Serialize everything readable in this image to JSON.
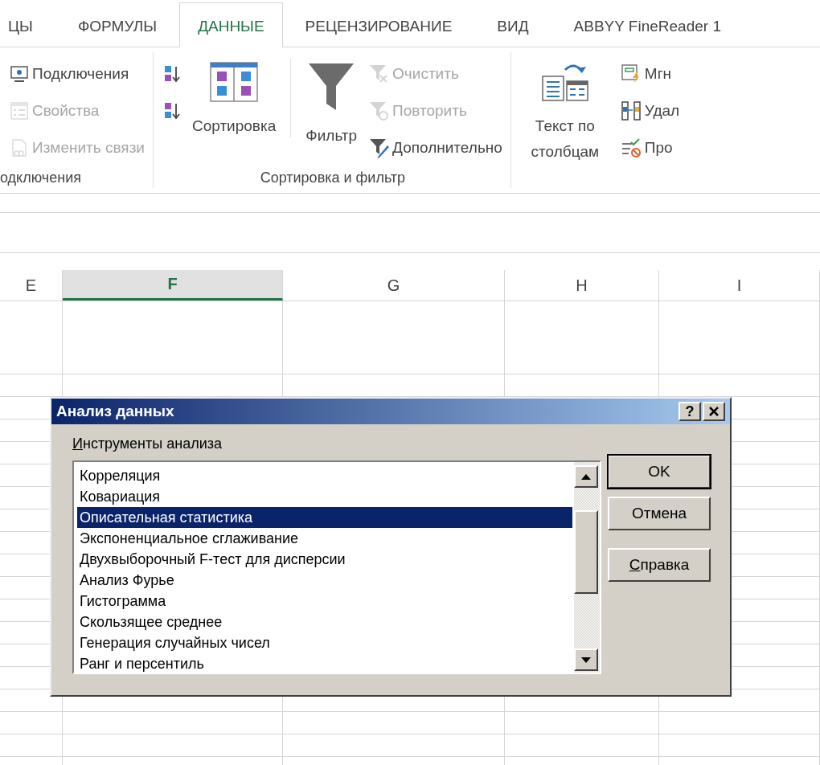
{
  "ribbon_tabs": [
    {
      "label": "ЦЫ",
      "selected": false
    },
    {
      "label": "ФОРМУЛЫ",
      "selected": false
    },
    {
      "label": "ДАННЫЕ",
      "selected": true
    },
    {
      "label": "РЕЦЕНЗИРОВАНИЕ",
      "selected": false
    },
    {
      "label": "ВИД",
      "selected": false
    },
    {
      "label": "ABBYY FineReader 1",
      "selected": false
    }
  ],
  "ribbon_groups": [
    {
      "label": "одключения",
      "columns": [
        {
          "kind": "stack",
          "items": [
            {
              "label": "Подключения",
              "disabled": false
            },
            {
              "label": "Свойства",
              "disabled": true
            },
            {
              "label": "Изменить связи",
              "disabled": true
            }
          ]
        }
      ]
    },
    {
      "label": "Сортировка и фильтр",
      "columns": [
        {
          "kind": "stack",
          "items": [
            {
              "disabled": false
            },
            {
              "disabled": false
            }
          ]
        },
        {
          "kind": "large",
          "label": "Сортировка"
        },
        {
          "kind": "divider"
        },
        {
          "kind": "large",
          "label": "Фильтр"
        },
        {
          "kind": "stack",
          "items": [
            {
              "label": "Очистить",
              "disabled": true
            },
            {
              "label": "Повторить",
              "disabled": true
            },
            {
              "label": "Дополнительно",
              "disabled": false
            }
          ]
        }
      ]
    },
    {
      "columns": [
        {
          "kind": "large",
          "label": "Текст по столбцам"
        },
        {
          "kind": "stack",
          "items": [
            {
              "label": "Мгн",
              "disabled": false
            },
            {
              "label": "Удал",
              "disabled": false
            },
            {
              "label": "Про",
              "disabled": false
            }
          ]
        }
      ]
    }
  ],
  "columns": [
    {
      "label": "E",
      "selected": false
    },
    {
      "label": "F",
      "selected": true
    },
    {
      "label": "G",
      "selected": false
    },
    {
      "label": "H",
      "selected": false
    },
    {
      "label": "I",
      "selected": false
    }
  ],
  "dialog": {
    "title": "Анализ данных",
    "help_button": "?",
    "list_label": {
      "text": "Инструменты анализа",
      "mnemonic": true
    },
    "tools": [
      {
        "label": "Корреляция",
        "selected": false
      },
      {
        "label": "Ковариация",
        "selected": false
      },
      {
        "label": "Описательная статистика",
        "selected": true
      },
      {
        "label": "Экспоненциальное сглаживание",
        "selected": false
      },
      {
        "label": "Двухвыборочный F-тест для дисперсии",
        "selected": false
      },
      {
        "label": "Анализ Фурье",
        "selected": false
      },
      {
        "label": "Гистограмма",
        "selected": false
      },
      {
        "label": "Скользящее среднее",
        "selected": false
      },
      {
        "label": "Генерация случайных чисел",
        "selected": false
      },
      {
        "label": "Ранг и персентиль",
        "selected": false
      }
    ],
    "buttons": [
      {
        "label": "OK",
        "default": true,
        "mnemonic": false
      },
      {
        "label": "Отмена",
        "default": false,
        "mnemonic": false
      },
      {
        "label": "Справка",
        "default": false,
        "mnemonic": true
      }
    ]
  }
}
